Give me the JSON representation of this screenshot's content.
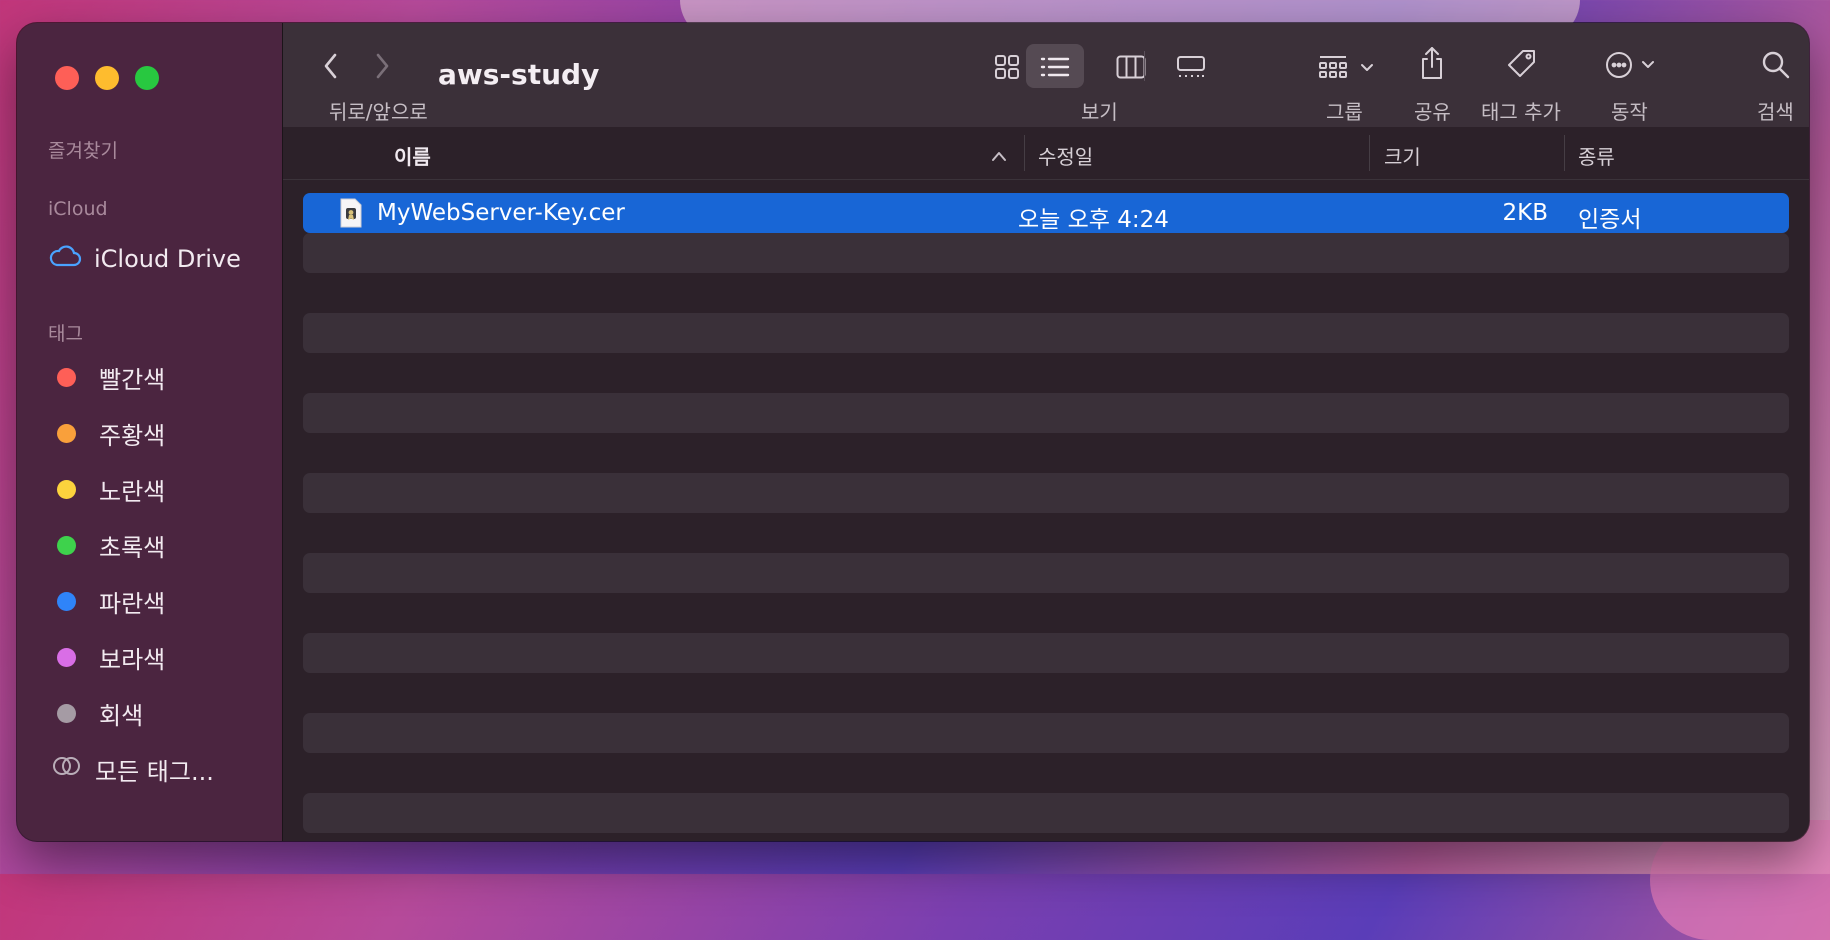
{
  "window": {
    "title": "aws-study",
    "nav_label": "뒤로/앞으로"
  },
  "sidebar": {
    "favorites_header": "즐겨찾기",
    "icloud_header": "iCloud",
    "icloud_drive": "iCloud Drive",
    "tags_header": "태그",
    "tags": [
      {
        "label": "빨간색",
        "color": "#fe5f57"
      },
      {
        "label": "주황색",
        "color": "#f9a03b"
      },
      {
        "label": "노란색",
        "color": "#fcd33d"
      },
      {
        "label": "초록색",
        "color": "#3ed24c"
      },
      {
        "label": "파란색",
        "color": "#2f84f9"
      },
      {
        "label": "보라색",
        "color": "#d96ee6"
      },
      {
        "label": "회색",
        "color": "#a59ba4"
      }
    ],
    "all_tags": "모든 태그..."
  },
  "toolbar": {
    "view_label": "보기",
    "group_label": "그룹",
    "share_label": "공유",
    "tag_label": "태그 추가",
    "action_label": "동작",
    "search_label": "검색"
  },
  "columns": {
    "name": "이름",
    "modified": "수정일",
    "size": "크기",
    "kind": "종류"
  },
  "files": [
    {
      "name": "MyWebServer-Key.cer",
      "modified": "오늘 오후 4:24",
      "size": "2KB",
      "kind": "인증서"
    }
  ],
  "colors": {
    "selection": "#1866d6"
  }
}
